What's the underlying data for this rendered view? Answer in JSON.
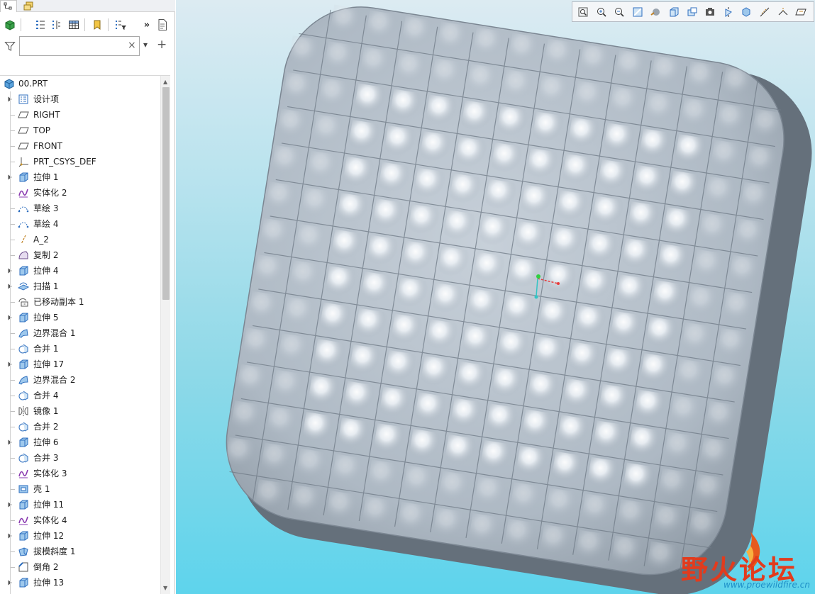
{
  "colors": {
    "accent": "#2f7fd0",
    "model_fill": "#b5c0cb",
    "model_edge": "#66717c",
    "viewport_top": "#dcebf2",
    "viewport_bottom": "#5ed4ec",
    "watermark": "#e23b1d"
  },
  "panel_tabs": [
    {
      "name": "model-tree-tab",
      "icon": "model-tree-icon",
      "active": true
    },
    {
      "name": "layer-tab",
      "icon": "layers-icon",
      "active": false
    }
  ],
  "tree_toolbar": {
    "overflow_label": "»",
    "icons": [
      "part-icon",
      "tree-settings-icon",
      "tree-columns-icon",
      "table-icon",
      "bookmark-icon",
      "tree-filter-icon",
      "details-icon"
    ]
  },
  "filter": {
    "value": "",
    "placeholder": "",
    "clear_label": "×",
    "dropdown_label": "▾",
    "add_label": "+"
  },
  "tree": {
    "root": {
      "label": "00.PRT",
      "icon": "part-icon"
    },
    "items": [
      {
        "label": "设计项",
        "icon": "design-items-icon",
        "expand": true
      },
      {
        "label": "RIGHT",
        "icon": "datum-plane-icon",
        "expand": false
      },
      {
        "label": "TOP",
        "icon": "datum-plane-icon",
        "expand": false
      },
      {
        "label": "FRONT",
        "icon": "datum-plane-icon",
        "expand": false
      },
      {
        "label": "PRT_CSYS_DEF",
        "icon": "csys-icon",
        "expand": false
      },
      {
        "label": "拉伸 1",
        "icon": "extrude-icon",
        "expand": true
      },
      {
        "label": "实体化 2",
        "icon": "solidify-icon",
        "expand": false
      },
      {
        "label": "草绘 3",
        "icon": "sketch-icon",
        "expand": false
      },
      {
        "label": "草绘 4",
        "icon": "sketch-icon",
        "expand": false
      },
      {
        "label": "A_2",
        "icon": "datum-axis-icon",
        "expand": false
      },
      {
        "label": "复制 2",
        "icon": "copy-icon",
        "expand": false
      },
      {
        "label": "拉伸 4",
        "icon": "extrude-icon",
        "expand": true
      },
      {
        "label": "扫描 1",
        "icon": "sweep-icon",
        "expand": true
      },
      {
        "label": "已移动副本 1",
        "icon": "moved-copy-icon",
        "expand": false
      },
      {
        "label": "拉伸 5",
        "icon": "extrude-icon",
        "expand": true
      },
      {
        "label": "边界混合 1",
        "icon": "boundary-blend-icon",
        "expand": false
      },
      {
        "label": "合并 1",
        "icon": "merge-icon",
        "expand": false
      },
      {
        "label": "拉伸 17",
        "icon": "extrude-icon",
        "expand": true
      },
      {
        "label": "边界混合 2",
        "icon": "boundary-blend-icon",
        "expand": false
      },
      {
        "label": "合并 4",
        "icon": "merge-icon",
        "expand": false
      },
      {
        "label": "镜像 1",
        "icon": "mirror-icon",
        "expand": false
      },
      {
        "label": "合并 2",
        "icon": "merge-icon",
        "expand": false
      },
      {
        "label": "拉伸 6",
        "icon": "extrude-icon",
        "expand": true
      },
      {
        "label": "合并 3",
        "icon": "merge-icon",
        "expand": false
      },
      {
        "label": "实体化 3",
        "icon": "solidify-icon",
        "expand": false
      },
      {
        "label": "壳 1",
        "icon": "shell-icon",
        "expand": false
      },
      {
        "label": "拉伸 11",
        "icon": "extrude-icon",
        "expand": true
      },
      {
        "label": "实体化 4",
        "icon": "solidify-icon",
        "expand": false
      },
      {
        "label": "拉伸 12",
        "icon": "extrude-icon",
        "expand": true
      },
      {
        "label": "拔模斜度 1",
        "icon": "draft-icon",
        "expand": false
      },
      {
        "label": "倒角 2",
        "icon": "chamfer-icon",
        "expand": false
      },
      {
        "label": "拉伸 13",
        "icon": "extrude-icon",
        "expand": true
      }
    ]
  },
  "view_toolbar": {
    "icons": [
      "refit-icon",
      "zoom-in-icon",
      "zoom-out-icon",
      "repaint-icon",
      "display-style-icon",
      "saved-views-icon",
      "view-manager-icon",
      "perspective-icon",
      "spin-center-icon",
      "section-icon",
      "datum-display-icon",
      "annotation-display-icon",
      "plane-display-icon"
    ]
  },
  "watermark": {
    "title": "野火论坛",
    "url": "www.proewildfire.cn"
  }
}
